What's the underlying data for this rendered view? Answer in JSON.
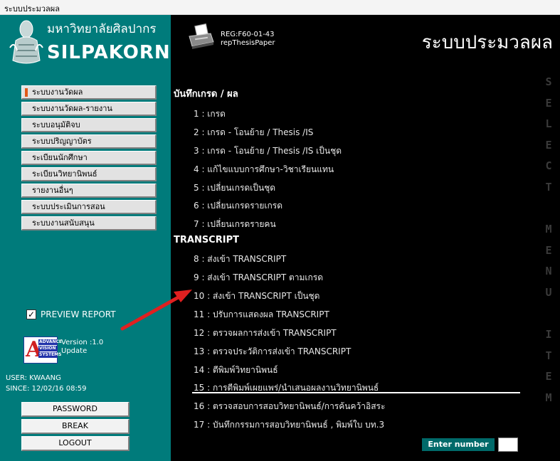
{
  "window": {
    "title": "ระบบประมวลผล"
  },
  "university": {
    "name_th": "มหาวิทยาลัยศิลปากร",
    "name_en": "SILPAKORN"
  },
  "sidebar_menu": [
    {
      "label": "ระบบงานวัดผล",
      "active": true
    },
    {
      "label": "ระบบงานวัดผล-รายงาน",
      "active": false
    },
    {
      "label": "ระบบอนุมัติจบ",
      "active": false
    },
    {
      "label": "ระบบปริญญาบัตร",
      "active": false
    },
    {
      "label": "ระเบียนนักศึกษา",
      "active": false
    },
    {
      "label": "ระเบียนวิทยานิพนธ์",
      "active": false
    },
    {
      "label": "รายงานอื่นๆ",
      "active": false
    },
    {
      "label": "ระบบประเมินการสอน",
      "active": false
    },
    {
      "label": "ระบบงานสนับสนุน",
      "active": false
    }
  ],
  "preview": {
    "label": "PREVIEW REPORT",
    "checked": true
  },
  "vendor": {
    "letter": "A",
    "words": [
      "ADVANCE",
      "VISION",
      "SYSTEMS"
    ],
    "version": "Version :1.0",
    "update": "Update"
  },
  "user": {
    "user_line": "USER: KWAANG",
    "since_line": "SINCE: 12/02/16 08:59"
  },
  "buttons": {
    "password": "PASSWORD",
    "break": "BREAK",
    "logout": "LOGOUT"
  },
  "report": {
    "code": "REG:F60-01-43",
    "name": "repThesisPaper"
  },
  "main_title": "ระบบประมวลผล",
  "sections": [
    {
      "title": "บันทึกเกรด / ผล",
      "items": [
        "1 : เกรด",
        "2 : เกรด - โอนย้าย / Thesis /IS",
        "3 : เกรด - โอนย้าย / Thesis /IS เป็นชุด",
        "4 : แก้ไขแบบการศึกษา-วิชาเรียนแทน",
        "5 : เปลี่ยนเกรดเป็นชุด",
        "6 : เปลี่ยนเกรดรายเกรด",
        "7 : เปลี่ยนเกรดรายคน"
      ]
    },
    {
      "title": "TRANSCRIPT",
      "items": [
        "8 : ส่งเข้า TRANSCRIPT",
        "9 : ส่งเข้า TRANSCRIPT ตามเกรด",
        "10 : ส่งเข้า TRANSCRIPT เป็นชุด",
        "11 : ปรับการแสดงผล TRANSCRIPT",
        "12 : ตรวจผลการส่งเข้า TRANSCRIPT",
        "13 : ตรวจประวัติการส่งเข้า TRANSCRIPT",
        "14 : ตีพิมพ์วิทยานิพนธ์",
        "15 : การตีพิมพ์เผยแพร่/นำเสนอผลงานวิทยานิพนธ์",
        "16 : ตรวจสอบการสอบวิทยานิพนธ์/การค้นคว้าอิสระ",
        "17 : บันทึกกรรมการสอบวิทยานิพนธ์ , พิมพ์ใบ บท.3"
      ]
    }
  ],
  "vertical_text": "SELECT MENU ITEM",
  "enter": {
    "label": "Enter number",
    "value": ""
  },
  "colors": {
    "sidebar": "#007b7b",
    "main_bg": "#000000",
    "arrow": "#e02020",
    "active_marker": "#e05a1a"
  }
}
